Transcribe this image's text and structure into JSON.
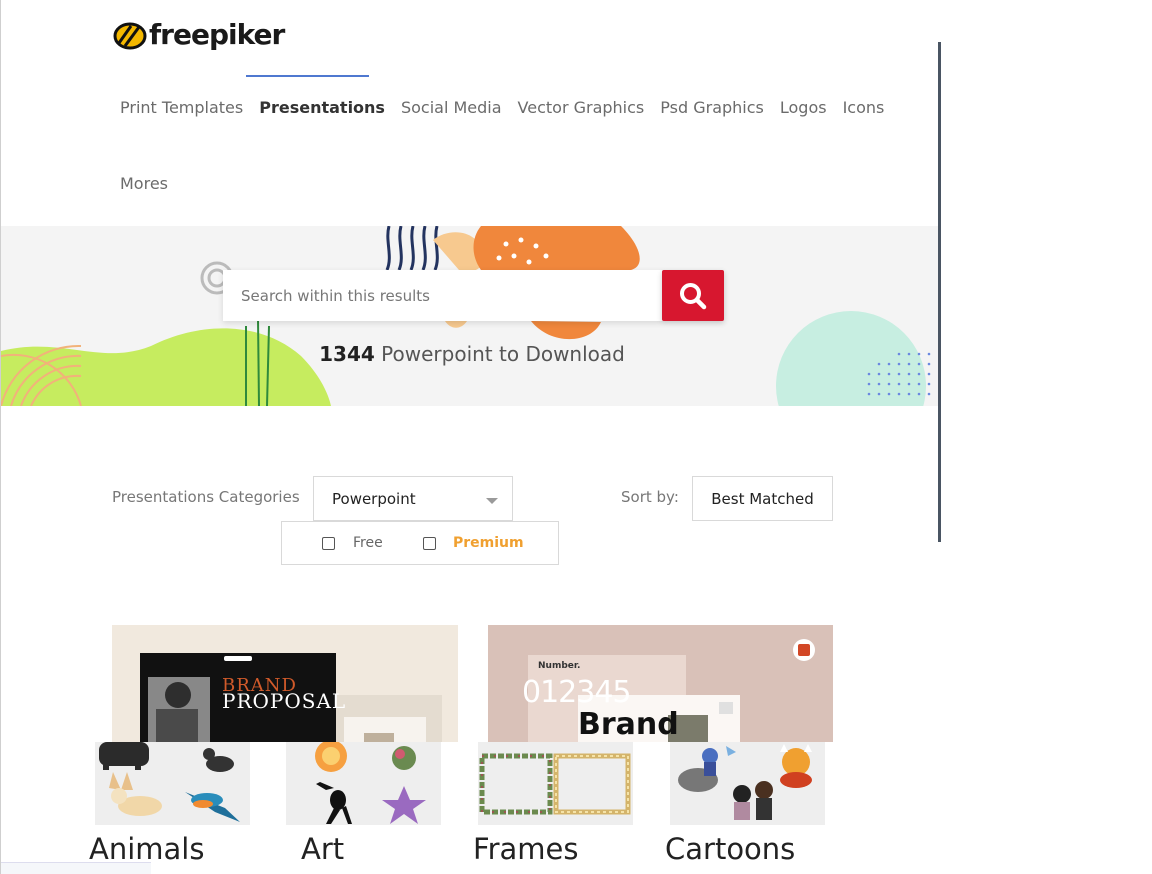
{
  "brand": {
    "name": "freepiker"
  },
  "nav": {
    "items": [
      "Print Templates",
      "Presentations",
      "Social Media",
      "Vector Graphics",
      "Psd Graphics",
      "Logos",
      "Icons"
    ],
    "active": "Presentations",
    "more": "Mores"
  },
  "hero": {
    "search_placeholder": "Search within this results",
    "count": "1344",
    "count_suffix": "Powerpoint to Download"
  },
  "filters": {
    "category_label": "Presentations Categories",
    "category_value": "Powerpoint",
    "sort_label": "Sort by:",
    "sort_value": "Best Matched",
    "free_label": "Free",
    "premium_label": "Premium",
    "free_checked": false,
    "premium_checked": false
  },
  "cards": [
    {
      "title_line1": "BRAND",
      "title_line2": "PROPOSAL"
    },
    {
      "label": "Number.",
      "digits": "012345",
      "word": "Brand"
    }
  ],
  "categories": [
    {
      "label": "Animals"
    },
    {
      "label": "Art"
    },
    {
      "label": "Frames"
    },
    {
      "label": "Cartoons"
    }
  ],
  "colors": {
    "accent": "#d7172f",
    "nav_underline": "#4f78d0",
    "premium": "#f0a030"
  }
}
